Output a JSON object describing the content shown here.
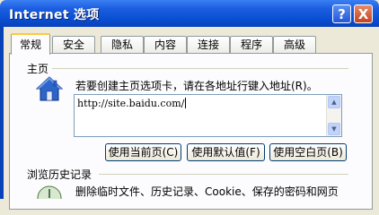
{
  "window": {
    "title": "Internet 选项",
    "help_label": "?",
    "close_label": "X"
  },
  "tabs": [
    {
      "label": "常规",
      "active": true
    },
    {
      "label": "安全",
      "active": false
    },
    {
      "label": "隐私",
      "active": false
    },
    {
      "label": "内容",
      "active": false
    },
    {
      "label": "连接",
      "active": false
    },
    {
      "label": "程序",
      "active": false
    },
    {
      "label": "高级",
      "active": false
    }
  ],
  "homepage": {
    "group_title": "主页",
    "icon": "house-icon",
    "instruction": "若要创建主页选项卡，请在各地址行键入地址(R)。",
    "url_value": "http://site.baidu.com/",
    "buttons": {
      "use_current": "使用当前页(C)",
      "use_default": "使用默认值(F)",
      "use_blank": "使用空白页(B)"
    }
  },
  "history": {
    "group_title": "浏览历史记录",
    "icon": "history-icon",
    "description": "删除临时文件、历史记录、Cookie、保存的密码和网页"
  },
  "colors": {
    "titlebar": "#0a4fd4",
    "dialog_bg": "#ece9d8",
    "panel_bg": "#fcfcfe",
    "active_tab_accent": "#ffc83c"
  }
}
